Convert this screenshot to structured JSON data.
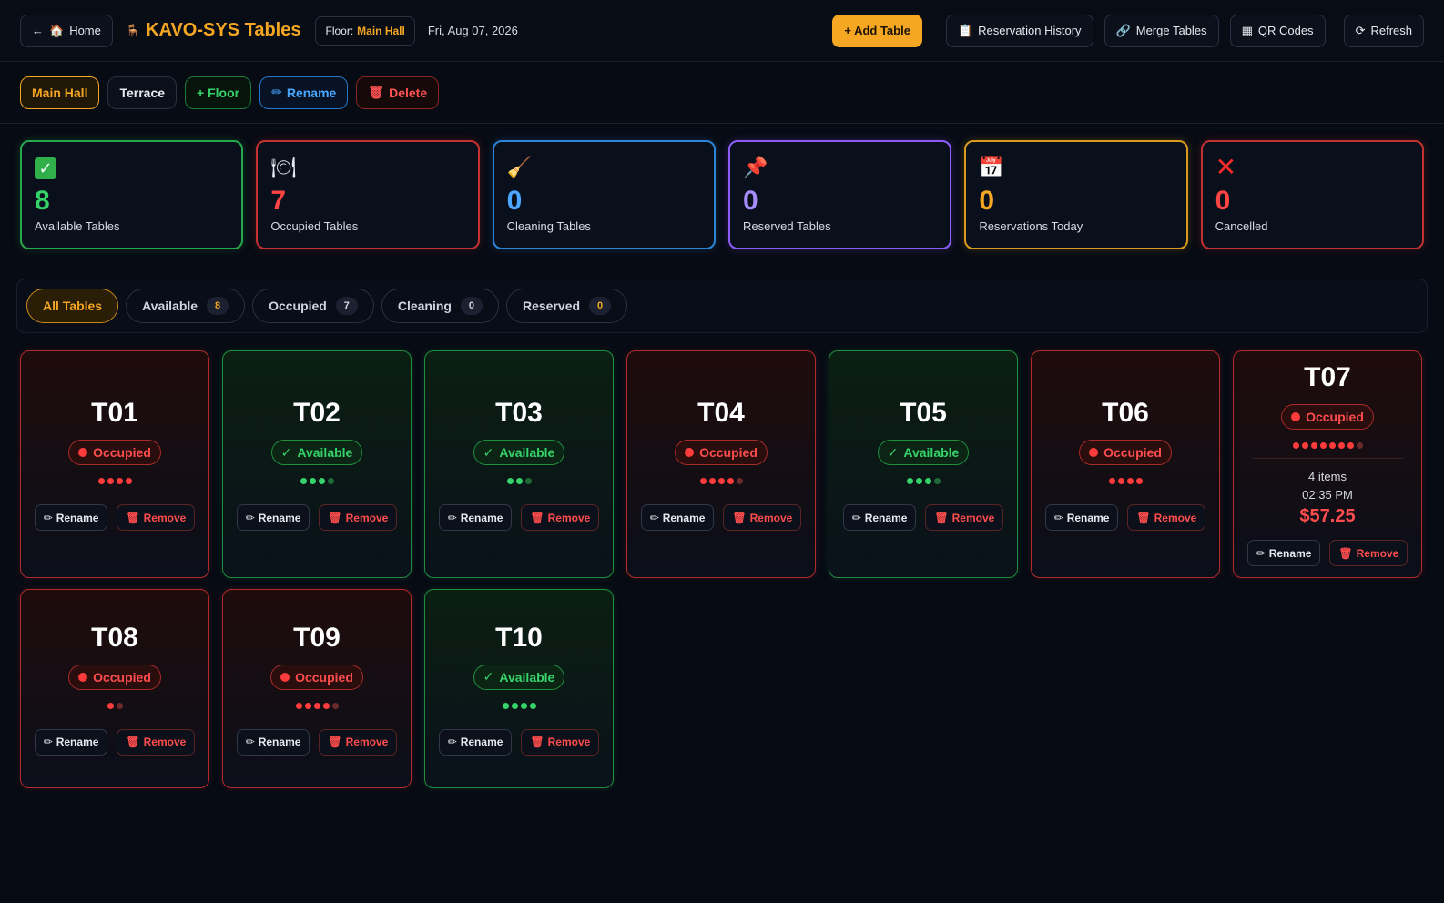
{
  "topbar": {
    "home_label": "Home",
    "title": "KAVO-SYS Tables",
    "floor_label": "Floor:",
    "floor_value": "Main Hall",
    "date": "Fri, Aug 07, 2026",
    "add_table_label": "+ Add Table",
    "reservation_history_label": "Reservation History",
    "merge_tables_label": "Merge Tables",
    "qr_codes_label": "QR Codes",
    "refresh_label": "Refresh"
  },
  "floors": {
    "items": [
      "Main Hall",
      "Terrace"
    ],
    "active": "Main Hall",
    "add_floor_label": "+ Floor",
    "rename_label": "Rename",
    "delete_label": "Delete"
  },
  "stats": [
    {
      "value": "8",
      "label": "Available Tables",
      "icon": "check-box-icon",
      "color": "#36d26a"
    },
    {
      "value": "7",
      "label": "Occupied Tables",
      "icon": "plate-cutlery-icon",
      "color": "#ff4444"
    },
    {
      "value": "0",
      "label": "Cleaning Tables",
      "icon": "broom-icon",
      "color": "#4aa6ff"
    },
    {
      "value": "0",
      "label": "Reserved Tables",
      "icon": "pushpin-icon",
      "color": "#a78bfa"
    },
    {
      "value": "0",
      "label": "Reservations Today",
      "icon": "calendar-icon",
      "color": "#f5a623"
    },
    {
      "value": "0",
      "label": "Cancelled",
      "icon": "cross-mark-icon",
      "color": "#ff2b2b"
    }
  ],
  "filters": [
    {
      "label": "All Tables",
      "count": null,
      "active": true
    },
    {
      "label": "Available",
      "count": "8"
    },
    {
      "label": "Occupied",
      "count": "7"
    },
    {
      "label": "Cleaning",
      "count": "0"
    },
    {
      "label": "Reserved",
      "count": "0"
    }
  ],
  "table_actions": {
    "rename_label": "Rename",
    "remove_label": "Remove"
  },
  "status_labels": {
    "occupied": "Occupied",
    "available": "Available"
  },
  "tables": [
    {
      "name": "T01",
      "status": "occupied",
      "seats": 4,
      "seats_filled": 4
    },
    {
      "name": "T02",
      "status": "available",
      "seats": 4,
      "seats_filled": 3
    },
    {
      "name": "T03",
      "status": "available",
      "seats": 3,
      "seats_filled": 2
    },
    {
      "name": "T04",
      "status": "occupied",
      "seats": 5,
      "seats_filled": 4
    },
    {
      "name": "T05",
      "status": "available",
      "seats": 4,
      "seats_filled": 3
    },
    {
      "name": "T06",
      "status": "occupied",
      "seats": 4,
      "seats_filled": 4
    },
    {
      "name": "T07",
      "status": "occupied",
      "seats": 8,
      "seats_filled": 7,
      "order": {
        "items": "4 items",
        "time": "02:35 PM",
        "total": "$57.25"
      }
    },
    {
      "name": "T08",
      "status": "occupied",
      "seats": 2,
      "seats_filled": 1
    },
    {
      "name": "T09",
      "status": "occupied",
      "seats": 5,
      "seats_filled": 4
    },
    {
      "name": "T10",
      "status": "available",
      "seats": 4,
      "seats_filled": 4
    }
  ]
}
